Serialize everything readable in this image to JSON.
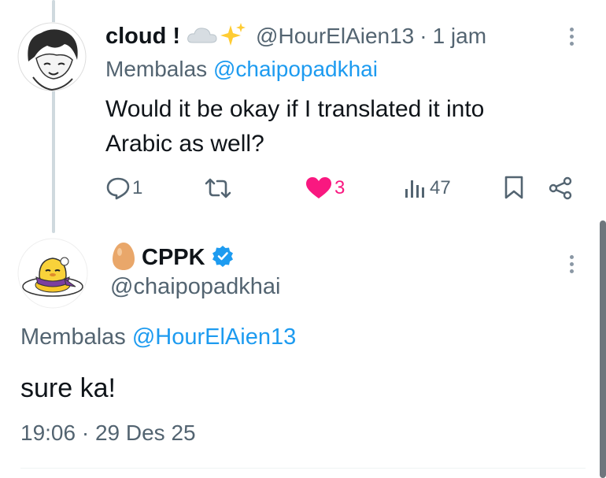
{
  "reply_tweet": {
    "display_name": "cloud !",
    "handle": "@HourElAien13",
    "separator": "·",
    "time": "1 jam",
    "replying_label": "Membalas",
    "replying_to": "@chaipopadkhai",
    "text": "Would it be okay if I translated it into Arabic as well?",
    "replies": "1",
    "likes": "3",
    "views": "47"
  },
  "main_tweet": {
    "display_name": "CPPK",
    "handle": "@chaipopadkhai",
    "replying_label": "Membalas",
    "replying_to": "@HourElAien13",
    "text": "sure ka!",
    "timestamp": "19:06 · 29 Des 25"
  },
  "colors": {
    "accent": "#1d9bf0",
    "like": "#f91880",
    "muted": "#536471",
    "verified": "#1d9bf0"
  },
  "icons": [
    "cloud-emoji",
    "sparkles-emoji",
    "egg-emoji",
    "verified-badge",
    "reply-icon",
    "retweet-icon",
    "heart-icon",
    "views-icon",
    "bookmark-icon",
    "share-icon",
    "more-icon"
  ]
}
